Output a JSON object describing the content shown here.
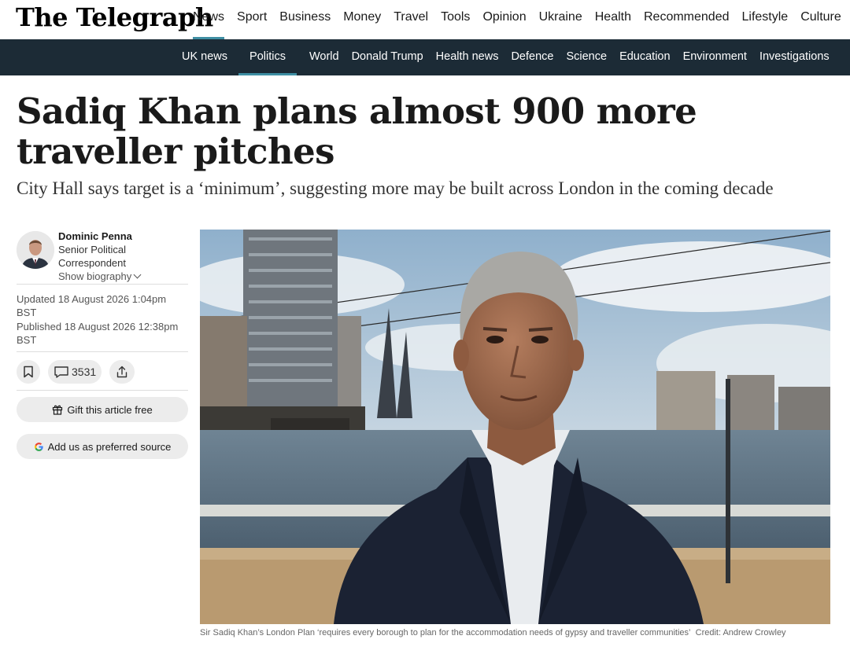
{
  "site": {
    "logo": "The Telegraph"
  },
  "primary_nav": [
    {
      "label": "News",
      "active": true
    },
    {
      "label": "Sport"
    },
    {
      "label": "Business"
    },
    {
      "label": "Money"
    },
    {
      "label": "Travel"
    },
    {
      "label": "Tools"
    },
    {
      "label": "Opinion"
    },
    {
      "label": "Ukraine"
    },
    {
      "label": "Health"
    },
    {
      "label": "Recommended"
    },
    {
      "label": "Lifestyle"
    },
    {
      "label": "Culture"
    }
  ],
  "secondary_nav": [
    {
      "label": "UK news"
    },
    {
      "label": "Politics",
      "active": true
    },
    {
      "label": "World"
    },
    {
      "label": "Donald Trump"
    },
    {
      "label": "Health news"
    },
    {
      "label": "Defence"
    },
    {
      "label": "Science"
    },
    {
      "label": "Education"
    },
    {
      "label": "Environment"
    },
    {
      "label": "Investigations"
    }
  ],
  "article": {
    "headline": "Sadiq Khan plans almost 900 more traveller pitches",
    "standfirst": "City Hall says target is a ‘minimum’, suggesting more may be built across London in the coming decade",
    "author": {
      "name": "Dominic Penna",
      "role_line1": "Senior Political",
      "role_line2": "Correspondent",
      "bio_link": "Show biography"
    },
    "updated_line1": "Updated 18 August 2026 1:04pm",
    "updated_line2": "BST",
    "published_line1": "Published 18 August 2026 12:38pm",
    "published_line2": "BST",
    "comment_count": "3531",
    "gift_label": "Gift this article free",
    "preferred_label": "Add us as preferred source",
    "caption": "Sir Sadiq Khan’s London Plan ‘requires every borough to plan for the accommodation needs of gypsy and traveller communities’",
    "credit": "Credit: Andrew Crowley"
  },
  "colors": {
    "accent": "#3f8fa4",
    "secondary_bar": "#1c2b36",
    "button_bg": "#ececec"
  }
}
